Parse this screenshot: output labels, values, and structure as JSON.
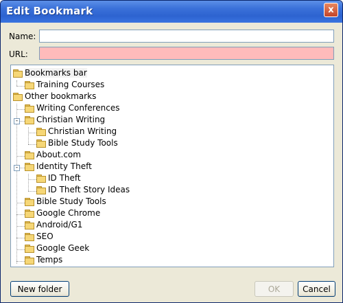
{
  "window": {
    "title": "Edit Bookmark",
    "close_label": "x"
  },
  "form": {
    "name_label": "Name:",
    "name_value": "",
    "url_label": "URL:",
    "url_value": "",
    "url_invalid_color": "#ffbbbb"
  },
  "tree": {
    "items": [
      {
        "label": "Bookmarks bar",
        "selected": true
      },
      {
        "label": "Training Courses"
      },
      {
        "label": "Other bookmarks"
      },
      {
        "label": "Writing Conferences"
      },
      {
        "label": "Christian Writing",
        "expander": "-"
      },
      {
        "label": "Christian Writing"
      },
      {
        "label": "Bible Study Tools"
      },
      {
        "label": "About.com"
      },
      {
        "label": "Identity Theft",
        "expander": "-"
      },
      {
        "label": "ID Theft"
      },
      {
        "label": "ID Theft Story Ideas"
      },
      {
        "label": "Bible Study Tools"
      },
      {
        "label": "Google Chrome"
      },
      {
        "label": "Android/G1"
      },
      {
        "label": "SEO"
      },
      {
        "label": "Google Geek"
      },
      {
        "label": "Temps"
      }
    ]
  },
  "buttons": {
    "new_folder": "New folder",
    "ok": "OK",
    "cancel": "Cancel"
  },
  "colors": {
    "titlebar": "#2d63d0",
    "dialog_bg": "#ece9d8",
    "folder": "#f6d777"
  }
}
